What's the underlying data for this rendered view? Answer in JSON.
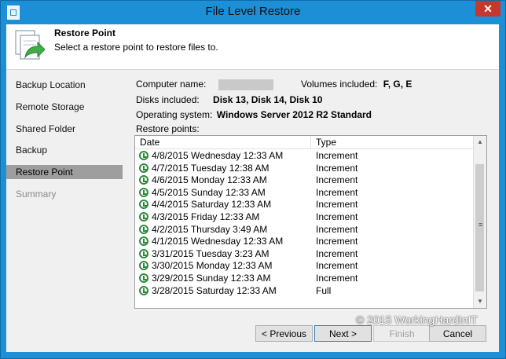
{
  "window": {
    "title": "File Level Restore",
    "close_glyph": "✕"
  },
  "header": {
    "title": "Restore Point",
    "subtitle": "Select a restore point to restore files to."
  },
  "sidebar": {
    "items": [
      {
        "label": "Backup Location",
        "state": "normal"
      },
      {
        "label": "Remote Storage",
        "state": "normal"
      },
      {
        "label": "Shared Folder",
        "state": "normal"
      },
      {
        "label": "Backup",
        "state": "normal"
      },
      {
        "label": "Restore Point",
        "state": "active"
      },
      {
        "label": "Summary",
        "state": "disabled"
      }
    ]
  },
  "info": {
    "computer_label": "Computer name:",
    "volumes_label": "Volumes included:",
    "volumes_value": "F, G, E",
    "disks_label": "Disks included:",
    "disks_value": "Disk 13, Disk 14, Disk 10",
    "os_label": "Operating system:",
    "os_value": "Windows Server 2012 R2 Standard"
  },
  "restore_points": {
    "label": "Restore points:",
    "columns": [
      "Date",
      "Type"
    ],
    "rows": [
      {
        "date": "4/8/2015 Wednesday 12:33 AM",
        "type": "Increment"
      },
      {
        "date": "4/7/2015 Tuesday 12:38 AM",
        "type": "Increment"
      },
      {
        "date": "4/6/2015 Monday 12:33 AM",
        "type": "Increment"
      },
      {
        "date": "4/5/2015 Sunday 12:33 AM",
        "type": "Increment"
      },
      {
        "date": "4/4/2015 Saturday 12:33 AM",
        "type": "Increment"
      },
      {
        "date": "4/3/2015 Friday 12:33 AM",
        "type": "Increment"
      },
      {
        "date": "4/2/2015 Thursday 3:49 AM",
        "type": "Increment"
      },
      {
        "date": "4/1/2015 Wednesday 12:33 AM",
        "type": "Increment"
      },
      {
        "date": "3/31/2015 Tuesday 3:23 AM",
        "type": "Increment"
      },
      {
        "date": "3/30/2015 Monday 12:33 AM",
        "type": "Increment"
      },
      {
        "date": "3/29/2015 Sunday 12:33 AM",
        "type": "Increment"
      },
      {
        "date": "3/28/2015 Saturday 12:33 AM",
        "type": "Full"
      }
    ]
  },
  "buttons": {
    "previous": "< Previous",
    "next": "Next >",
    "finish": "Finish",
    "cancel": "Cancel"
  },
  "watermark": "© 2015 WorkingHardInIT",
  "colors": {
    "titlebar": "#1c8fd6",
    "close": "#c7372f",
    "selected_nav": "#9e9e9e",
    "restore_icon": "#2e8b3a"
  }
}
